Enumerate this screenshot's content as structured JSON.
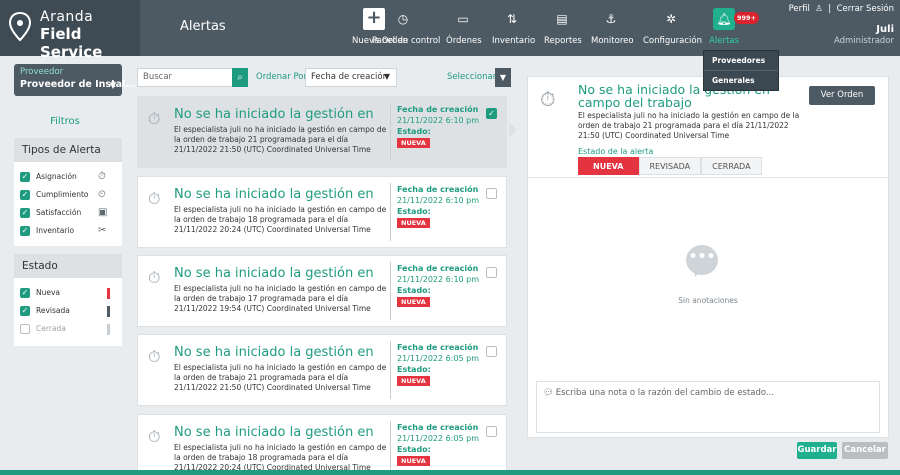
{
  "brand": {
    "line1": "Aranda",
    "line2": "Field Service"
  },
  "header": {
    "title": "Alertas"
  },
  "nav": [
    {
      "label": "Nueva Orden",
      "icon": "plus-icon"
    },
    {
      "label": "Panel de control",
      "icon": "clock-icon"
    },
    {
      "label": "Órdenes",
      "icon": "orders-icon"
    },
    {
      "label": "Inventario",
      "icon": "inventory-icon"
    },
    {
      "label": "Reportes",
      "icon": "reports-icon"
    },
    {
      "label": "Monitoreo",
      "icon": "monitor-icon"
    },
    {
      "label": "Configuración",
      "icon": "gear-icon"
    },
    {
      "label": "Alertas",
      "icon": "bell-icon"
    }
  ],
  "alert_badge": "999+",
  "user": {
    "perfil": "Perfil",
    "cerrar": "Cerrar Sesión",
    "name": "Juli",
    "role": "Administrador"
  },
  "alert_menu": [
    "Proveedores",
    "Generales"
  ],
  "provider": {
    "label": "Proveedor",
    "value": "Proveedor de Instal..."
  },
  "filters_title": "Filtros",
  "tipos": {
    "title": "Tipos de Alerta",
    "items": [
      {
        "label": "Asignación",
        "checked": true
      },
      {
        "label": "Cumplimiento",
        "checked": true
      },
      {
        "label": "Satisfacción",
        "checked": true
      },
      {
        "label": "Inventario",
        "checked": true
      }
    ]
  },
  "estado": {
    "title": "Estado",
    "items": [
      {
        "label": "Nueva",
        "checked": true,
        "color": "#e3343f"
      },
      {
        "label": "Revisada",
        "checked": true,
        "color": "#4d5a64"
      },
      {
        "label": "Cerrada",
        "checked": false,
        "color": "#c8ced2"
      }
    ]
  },
  "toolbar": {
    "search_placeholder": "Buscar",
    "order_label": "Ordenar Por",
    "order_value": "Fecha de creación",
    "select_label": "Seleccionar"
  },
  "cards": [
    {
      "title": "No se ha iniciado la gestión en",
      "desc": "El especialista juli no ha iniciado la gestión en campo de la orden de trabajo 21 programada para el día 21/11/2022 21:50 (UTC) Coordinated Universal Time",
      "fecha_label": "Fecha de creación",
      "fecha": "21/11/2022 6:10 pm",
      "estado_label": "Estado:",
      "estado": "NUEVA",
      "selected": true
    },
    {
      "title": "No se ha iniciado la gestión en",
      "desc": "El especialista juli no ha iniciado la gestión en campo de la orden de trabajo 18 programada para el día 21/11/2022 20:24 (UTC) Coordinated Universal Time",
      "fecha_label": "Fecha de creación",
      "fecha": "21/11/2022 6:10 pm",
      "estado_label": "Estado:",
      "estado": "NUEVA",
      "selected": false
    },
    {
      "title": "No se ha iniciado la gestión en",
      "desc": "El especialista juli no ha iniciado la gestión en campo de la orden de trabajo 17 programada para el día 21/11/2022 19:54 (UTC) Coordinated Universal Time",
      "fecha_label": "Fecha de creación",
      "fecha": "21/11/2022 6:10 pm",
      "estado_label": "Estado:",
      "estado": "NUEVA",
      "selected": false
    },
    {
      "title": "No se ha iniciado la gestión en",
      "desc": "El especialista juli no ha iniciado la gestión en campo de la orden de trabajo 21 programada para el día 21/11/2022 21:50 (UTC) Coordinated Universal Time",
      "fecha_label": "Fecha de creación",
      "fecha": "21/11/2022 6:05 pm",
      "estado_label": "Estado:",
      "estado": "NUEVA",
      "selected": false
    },
    {
      "title": "No se ha iniciado la gestión en",
      "desc": "El especialista juli no ha iniciado la gestión en campo de la orden de trabajo 18 programada para el día 21/11/2022 20:24 (UTC) Coordinated Universal Time",
      "fecha_label": "Fecha de creación",
      "fecha": "21/11/2022 6:05 pm",
      "estado_label": "Estado:",
      "estado": "NUEVA",
      "selected": false
    }
  ],
  "detail": {
    "title": "No se ha iniciado la gestión en campo del trabajo",
    "desc": "El especialista juli no ha iniciado la gestión en campo de la orden de trabajo 21 programada para el día 21/11/2022 21:50 (UTC) Coordinated Universal Time",
    "estado_label": "Estado de la alerta",
    "states": [
      "NUEVA",
      "REVISADA",
      "CERRADA"
    ],
    "active_state": "NUEVA",
    "ver_orden": "Ver Orden",
    "no_annotations": "Sin anotaciones",
    "note_placeholder": "Escriba una nota o la razón del cambio de estado..."
  },
  "actions": {
    "save": "Guardar",
    "cancel": "Cancelar"
  },
  "colors": {
    "accent": "#1f9c80",
    "header": "#4d5a64",
    "new": "#e3343f"
  }
}
